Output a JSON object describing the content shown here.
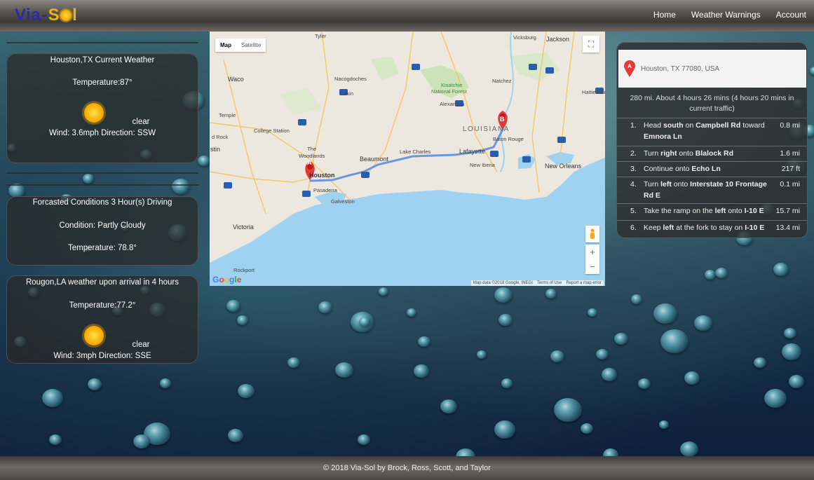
{
  "app": {
    "logo": {
      "part1": "Via",
      "dash": "-",
      "part2": "S",
      "part3": "l"
    },
    "nav": [
      "Home",
      "Weather Warnings",
      "Account"
    ]
  },
  "current_weather": {
    "title": "Houston,TX Current Weather",
    "temperature": "Temperature:87°",
    "condition": "clear",
    "wind": "Wind: 3.6mph Direction: SSW",
    "icon": "sun-icon"
  },
  "forecast": {
    "title": "Forcasted Conditions 3 Hour(s) Driving",
    "condition": "Condition: Partly Cloudy",
    "temperature": "Temperature: 78.8°"
  },
  "arrival": {
    "title": "Rougon,LA weather upon arrival in 4 hours",
    "temperature": "Temperature:77.2°",
    "condition": "clear",
    "wind": "Wind: 3mph Direction: SSE",
    "icon": "sun-icon"
  },
  "map": {
    "tabs": [
      "Map",
      "Satellite"
    ],
    "zoom_in": "+",
    "zoom_out": "−",
    "google": "Google",
    "footer": [
      "Map data ©2018 Google, INEGI",
      "Terms of Use",
      "Report a map error"
    ],
    "marker_a": "A",
    "marker_b": "B",
    "labels": {
      "tyler": "Tyler",
      "vicksburg": "Vicksburg",
      "jackson": "Jackson",
      "waco": "Waco",
      "nacogdoches": "Nacogdoches",
      "kisatchie": "Kisatchie",
      "national_forest": "National Forest",
      "natchez": "Natchez",
      "lufkin": "Lufkin",
      "hattiesburg": "Hattiesburg",
      "alexandria": "Alexandria",
      "temple": "Temple",
      "college_station": "College Station",
      "louisiana": "LOUISIANA",
      "round_rock": "d Rock",
      "austin": "stin",
      "the_woodlands": "The\nWoodlands",
      "baton_rouge": "Baton Rouge",
      "lake_charles": "Lake Charles",
      "lafayette": "Lafayette",
      "beaumont": "Beaumont",
      "houston": "Houston",
      "new_iberia": "New Iberia",
      "new_orleans": "New Orleans",
      "pasadena": "Pasadena",
      "galveston": "Galveston",
      "victoria": "Victoria",
      "rockport": "Rockport"
    },
    "highways": [
      "20",
      "49",
      "59",
      "55",
      "45",
      "10",
      "45",
      "12",
      "10",
      "10",
      "10",
      "49",
      "69",
      "69",
      "35"
    ]
  },
  "directions": {
    "address": "Houston, TX 77080, USA",
    "summary": "280 mi. About 4 hours 26 mins (4 hours 20 mins in current traffic)",
    "steps": [
      {
        "n": "1.",
        "pre": "Head ",
        "b1": "south",
        "mid": " on ",
        "b2": "Campbell Rd",
        "post": " toward ",
        "b3": "Emnora Ln",
        "dist": "0.8 mi"
      },
      {
        "n": "2.",
        "pre": "Turn ",
        "b1": "right",
        "mid": " onto ",
        "b2": "Blalock Rd",
        "post": "",
        "b3": "",
        "dist": "1.6 mi"
      },
      {
        "n": "3.",
        "pre": "Continue onto ",
        "b1": "Echo Ln",
        "mid": "",
        "b2": "",
        "post": "",
        "b3": "",
        "dist": "217 ft"
      },
      {
        "n": "4.",
        "pre": "Turn ",
        "b1": "left",
        "mid": " onto ",
        "b2": "Interstate 10 Frontage Rd E",
        "post": "",
        "b3": "",
        "dist": "0.1 mi"
      },
      {
        "n": "5.",
        "pre": "Take the ramp on the ",
        "b1": "left",
        "mid": " onto ",
        "b2": "I-10 E",
        "post": "",
        "b3": "",
        "dist": "15.7 mi"
      },
      {
        "n": "6.",
        "pre": "Keep ",
        "b1": "left",
        "mid": " at the fork to stay on ",
        "b2": "I-10 E",
        "post": "",
        "b3": "",
        "dist": "13.4 mi"
      }
    ]
  },
  "footer": "© 2018 Via-Sol by Brock, Ross, Scott, and Taylor"
}
